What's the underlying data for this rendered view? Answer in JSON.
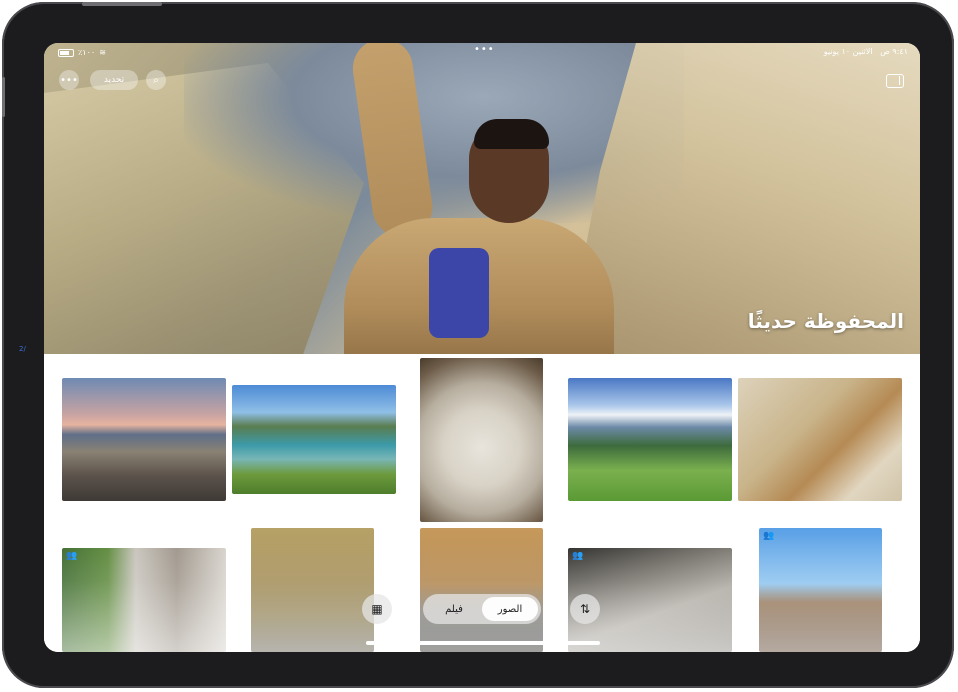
{
  "status_bar": {
    "time": "٩:٤١ ص",
    "date": "الاثنين ١٠ يونيو",
    "carrier": "٪١٠٠",
    "menu_dots": "•••"
  },
  "toolbar": {
    "more_icon": "ellipsis-icon",
    "more_label": "•••",
    "select_label": "تحديد",
    "search_icon": "search-icon",
    "search_glyph": "⌕",
    "sidebar_icon": "sidebar-icon"
  },
  "hero": {
    "title": "المحفوظة حديثًا"
  },
  "bottom_bar": {
    "grid_icon": "grid-icon",
    "grid_glyph": "▦",
    "tabs": [
      {
        "label": "الصور",
        "active": true
      },
      {
        "label": "فيلم",
        "active": false
      }
    ],
    "sort_icon": "sort-arrows-icon",
    "sort_glyph": "⇅"
  },
  "side_label": "2/",
  "photos": [
    {
      "subject": "coastal-road",
      "shared": false
    },
    {
      "subject": "beach-bay",
      "shared": false
    },
    {
      "subject": "dog",
      "shared": false
    },
    {
      "subject": "mountain-meadow",
      "shared": false
    },
    {
      "subject": "dancer",
      "shared": false
    },
    {
      "subject": "man-back",
      "shared": true
    },
    {
      "subject": "man-brick-wall",
      "shared": false
    },
    {
      "subject": "brick-building",
      "shared": false
    },
    {
      "subject": "street-shadow",
      "shared": true
    },
    {
      "subject": "jumping-man",
      "shared": true
    }
  ],
  "colors": {
    "device_frame": "#1c1c1e",
    "screen_bg": "#ffffff",
    "accent": "#3a6fd8"
  }
}
